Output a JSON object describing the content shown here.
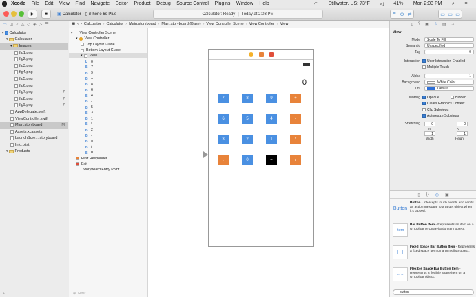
{
  "menubar": {
    "app": "Xcode",
    "items": [
      "File",
      "Edit",
      "View",
      "Find",
      "Navigate",
      "Editor",
      "Product",
      "Debug",
      "Source Control",
      "Plugins",
      "Window",
      "Help"
    ],
    "weather": "Stillwater, US: 73°F",
    "battery": "41%",
    "clock": "Mon 2:03 PM"
  },
  "toolbar": {
    "scheme": "Calculator",
    "device": "iPhone 6s Plus",
    "status": "Calculator: Ready",
    "status_time": "Today at 2:03 PM"
  },
  "navigator": {
    "files": [
      {
        "name": "Calculator",
        "kind": "project",
        "indent": 0,
        "badge": ""
      },
      {
        "name": "Calculator",
        "kind": "folder",
        "indent": 1,
        "badge": ""
      },
      {
        "name": "Images",
        "kind": "folder",
        "indent": 2,
        "badge": "",
        "selected": true
      },
      {
        "name": "fig1.png",
        "kind": "file",
        "indent": 3,
        "badge": ""
      },
      {
        "name": "fig2.png",
        "kind": "file",
        "indent": 3,
        "badge": ""
      },
      {
        "name": "fig3.png",
        "kind": "file",
        "indent": 3,
        "badge": ""
      },
      {
        "name": "fig4.png",
        "kind": "file",
        "indent": 3,
        "badge": ""
      },
      {
        "name": "fig5.png",
        "kind": "file",
        "indent": 3,
        "badge": ""
      },
      {
        "name": "fig6.png",
        "kind": "file",
        "indent": 3,
        "badge": ""
      },
      {
        "name": "fig7.png",
        "kind": "file",
        "indent": 3,
        "badge": "?"
      },
      {
        "name": "fig8.png",
        "kind": "file",
        "indent": 3,
        "badge": "?"
      },
      {
        "name": "fig9.png",
        "kind": "file",
        "indent": 3,
        "badge": "?"
      },
      {
        "name": "AppDelegate.swift",
        "kind": "file",
        "indent": 2,
        "badge": ""
      },
      {
        "name": "ViewController.swift",
        "kind": "file",
        "indent": 2,
        "badge": ""
      },
      {
        "name": "Main.storyboard",
        "kind": "file",
        "indent": 2,
        "badge": "M",
        "selected2": true
      },
      {
        "name": "Assets.xcassets",
        "kind": "file",
        "indent": 2,
        "badge": ""
      },
      {
        "name": "LaunchScre....storyboard",
        "kind": "file",
        "indent": 2,
        "badge": ""
      },
      {
        "name": "Info.plist",
        "kind": "file",
        "indent": 2,
        "badge": ""
      },
      {
        "name": "Products",
        "kind": "folder",
        "indent": 1,
        "badge": ""
      }
    ],
    "filter_placeholder": ""
  },
  "jumpbar": [
    "Calculator",
    "Calculator",
    "Main.storyboard",
    "Main.storyboard (Base)",
    "View Controller Scene",
    "View Controller",
    "View"
  ],
  "outline": {
    "rows": [
      {
        "label": "View Controller Scene",
        "indent": 0,
        "type": "scene"
      },
      {
        "label": "View Controller",
        "indent": 1,
        "type": "vc"
      },
      {
        "label": "Top Layout Guide",
        "indent": 2,
        "type": "box"
      },
      {
        "label": "Bottom Layout Guide",
        "indent": 2,
        "type": "box"
      },
      {
        "label": "View",
        "indent": 2,
        "type": "box",
        "selected": true
      },
      {
        "label": "0",
        "indent": 3,
        "type": "L"
      },
      {
        "label": "7",
        "indent": 3,
        "type": "B"
      },
      {
        "label": "9",
        "indent": 3,
        "type": "B"
      },
      {
        "label": "+",
        "indent": 3,
        "type": "B"
      },
      {
        "label": "8",
        "indent": 3,
        "type": "B"
      },
      {
        "label": "6",
        "indent": 3,
        "type": "B"
      },
      {
        "label": "4",
        "indent": 3,
        "type": "B"
      },
      {
        "label": "-",
        "indent": 3,
        "type": "B"
      },
      {
        "label": "5",
        "indent": 3,
        "type": "B"
      },
      {
        "label": "3",
        "indent": 3,
        "type": "B"
      },
      {
        "label": "1",
        "indent": 3,
        "type": "B"
      },
      {
        "label": "*",
        "indent": 3,
        "type": "B"
      },
      {
        "label": "2",
        "indent": 3,
        "type": "B"
      },
      {
        "label": ".",
        "indent": 3,
        "type": "B"
      },
      {
        "label": "=",
        "indent": 3,
        "type": "B"
      },
      {
        "label": "/",
        "indent": 3,
        "type": "B"
      },
      {
        "label": "0",
        "indent": 3,
        "type": "B"
      },
      {
        "label": "First Responder",
        "indent": 1,
        "type": "fr"
      },
      {
        "label": "Exit",
        "indent": 1,
        "type": "exit"
      },
      {
        "label": "Storyboard Entry Point",
        "indent": 1,
        "type": "entry"
      }
    ],
    "filter_placeholder": "Filter"
  },
  "calculator": {
    "display": "0",
    "keys": [
      {
        "label": "7",
        "color": "#4a90e2",
        "row": 0,
        "col": 0
      },
      {
        "label": "8",
        "color": "#4a90e2",
        "row": 0,
        "col": 1
      },
      {
        "label": "9",
        "color": "#4a90e2",
        "row": 0,
        "col": 2
      },
      {
        "label": "+",
        "color": "#e8833a",
        "row": 0,
        "col": 3
      },
      {
        "label": "6",
        "color": "#4a90e2",
        "row": 1,
        "col": 0
      },
      {
        "label": "5",
        "color": "#4a90e2",
        "row": 1,
        "col": 1
      },
      {
        "label": "4",
        "color": "#4a90e2",
        "row": 1,
        "col": 2
      },
      {
        "label": "-",
        "color": "#e8833a",
        "row": 1,
        "col": 3
      },
      {
        "label": "3",
        "color": "#4a90e2",
        "row": 2,
        "col": 0
      },
      {
        "label": "2",
        "color": "#4a90e2",
        "row": 2,
        "col": 1
      },
      {
        "label": "1",
        "color": "#4a90e2",
        "row": 2,
        "col": 2
      },
      {
        "label": "*",
        "color": "#e8833a",
        "row": 2,
        "col": 3
      },
      {
        "label": ".",
        "color": "#e8833a",
        "row": 3,
        "col": 0
      },
      {
        "label": "0",
        "color": "#4a90e2",
        "row": 3,
        "col": 1
      },
      {
        "label": "=",
        "color": "#000000",
        "row": 3,
        "col": 2
      },
      {
        "label": "/",
        "color": "#e8833a",
        "row": 3,
        "col": 3
      }
    ]
  },
  "inspector": {
    "heading": "View",
    "mode_label": "Mode",
    "mode_value": "Scale To Fill",
    "semantic_label": "Semantic",
    "semantic_value": "Unspecified",
    "tag_label": "Tag",
    "tag_value": "0",
    "interaction_label": "Interaction",
    "user_interaction": "User Interaction Enabled",
    "multiple_touch": "Multiple Touch",
    "alpha_label": "Alpha",
    "alpha_value": "1",
    "background_label": "Background",
    "background_value": "White Color",
    "tint_label": "Tint",
    "tint_value": "Default",
    "drawing_label": "Drawing",
    "opaque": "Opaque",
    "hidden": "Hidden",
    "clears": "Clears Graphics Context",
    "clip": "Clip Subviews",
    "autoresize": "Autoresize Subviews",
    "stretching_label": "Stretching",
    "stretch_x": "0",
    "stretch_y": "0",
    "stretch_w": "1",
    "stretch_h": "1",
    "x_label": "X",
    "y_label": "Y",
    "width_label": "Width",
    "height_label": "Height"
  },
  "library": {
    "items": [
      {
        "thumb": "Button",
        "title": "Button",
        "text": " - Intercepts touch events and sends an action message to a target object when it's tapped."
      },
      {
        "thumb": "Item",
        "title": "Bar Button Item",
        "text": " - Represents an item on a UIToolbar or UINavigationItem object."
      },
      {
        "thumb": "",
        "title": "Fixed Space Bar Button Item",
        "text": " - Represents a fixed space item on a UIToolbar object."
      },
      {
        "thumb": "",
        "title": "Flexible Space Bar Button Item",
        "text": " - Represents a flexible space item on a UIToolbar object."
      }
    ],
    "search_value": "button"
  }
}
